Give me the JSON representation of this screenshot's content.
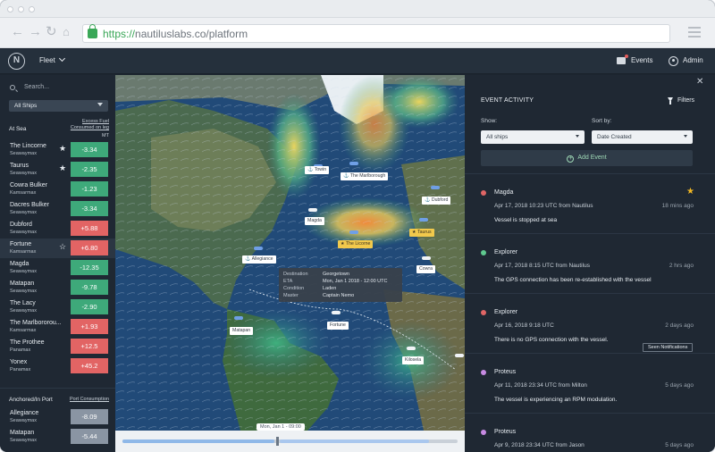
{
  "browser": {
    "url_scheme": "https://",
    "url_rest": "nautiluslabs.co/platform"
  },
  "header": {
    "logo_letter": "N",
    "fleet_label": "Fleet",
    "events_label": "Events",
    "admin_label": "Admin"
  },
  "sidebar": {
    "search_placeholder": "Search...",
    "ships_filter": "All Ships",
    "at_sea_label": "At Sea",
    "excess_fuel_header": "Excess Fuel Consumed on leg",
    "excess_fuel_unit": "MT",
    "at_sea_ships": [
      {
        "name": "The Lincorne",
        "class": "Seawaymax",
        "value": "-3.34",
        "status": "good",
        "starred": "★"
      },
      {
        "name": "Taurus",
        "class": "Seawaymax",
        "value": "-2.35",
        "status": "good",
        "starred": "★"
      },
      {
        "name": "Cowra Bulker",
        "class": "Kamsarmax",
        "value": "-1.23",
        "status": "good",
        "starred": ""
      },
      {
        "name": "Dacres Bulker",
        "class": "Seawaymax",
        "value": "-3.34",
        "status": "good",
        "starred": ""
      },
      {
        "name": "Dubford",
        "class": "Seawaymax",
        "value": "+5.88",
        "status": "bad",
        "starred": ""
      },
      {
        "name": "Fortune",
        "class": "Kamsarmax",
        "value": "+6.80",
        "status": "bad",
        "starred": "☆"
      },
      {
        "name": "Magda",
        "class": "Seawaymax",
        "value": "-12.35",
        "status": "good",
        "starred": ""
      },
      {
        "name": "Matapan",
        "class": "Seawaymax",
        "value": "-9.78",
        "status": "good",
        "starred": ""
      },
      {
        "name": "The Lacy",
        "class": "Seawaymax",
        "value": "-2.90",
        "status": "good",
        "starred": ""
      },
      {
        "name": "The Marlbororou...",
        "class": "Kamsarmax",
        "value": "+1.93",
        "status": "bad",
        "starred": ""
      },
      {
        "name": "The Prothee",
        "class": "Panamax",
        "value": "+12.5",
        "status": "bad",
        "starred": ""
      },
      {
        "name": "Yonex",
        "class": "Panamax",
        "value": "+45.2",
        "status": "bad",
        "starred": ""
      }
    ],
    "anchored_label": "Anchored/In Port",
    "port_consumption_header": "Port Consumption",
    "anchored_ships": [
      {
        "name": "Allegiance",
        "class": "Seawaymax",
        "value": "-8.09"
      },
      {
        "name": "Matapan",
        "class": "Seawaymax",
        "value": "-5.44"
      }
    ]
  },
  "map": {
    "ship_labels": {
      "towin": "Towin",
      "marlborough": "The Marlborough",
      "dubford": "Dubford",
      "magda": "Magda",
      "lincorne": "The Licorne",
      "taurus": "Taurus",
      "allegiance": "Allegiance",
      "cowra": "Cowra",
      "fortune": "Fortune",
      "matapan": "Matapan",
      "kilosela": "Kilosela"
    },
    "tooltip": {
      "destination_label": "Destination",
      "destination_value": "Georgetown",
      "eta_label": "ETA",
      "eta_value": "Mon, Jan 1 2018 - 12:00 UTC",
      "condition_label": "Condition",
      "condition_value": "Laden",
      "master_label": "Master",
      "master_value": "Captain Nemo"
    },
    "time_label": "Mon, Jan 1 - 09:00",
    "timeline_progress": 0.5
  },
  "panel": {
    "title": "EVENT ACTIVITY",
    "filters_label": "Filters",
    "show_label": "Show:",
    "show_value": "All ships",
    "sort_label": "Sort by:",
    "sort_value": "Date Created",
    "add_event_label": "Add Event",
    "seen_notifications_label": "Seen Notifications",
    "events": [
      {
        "ship": "Magda",
        "date": "Apr 17, 2018 10:23 UTC from Nautilus",
        "ago": "18 mins ago",
        "message": "Vessel is stopped at sea",
        "dot_color": "#e06666",
        "star": "★"
      },
      {
        "ship": "Explorer",
        "date": "Apr 17, 2018 8:15 UTC from Nautilus",
        "ago": "2 hrs ago",
        "message": "The GPS connection has been re-established with the vessel",
        "dot_color": "#5fc98f",
        "star": ""
      },
      {
        "ship": "Explorer",
        "date": "Apr 16, 2018 9:18 UTC",
        "ago": "2 days ago",
        "message": "There is no GPS connection with the vessel.",
        "dot_color": "#e06666",
        "star": ""
      },
      {
        "ship": "Proteus",
        "date": "Apr 11, 2018 23:34 UTC from Milton",
        "ago": "5 days ago",
        "message": "The vessel is experiencing an RPM modulation.",
        "dot_color": "#c78be3",
        "star": ""
      },
      {
        "ship": "Proteus",
        "date": "Apr 9, 2018 23:34 UTC from Jason",
        "ago": "5 days ago",
        "message": "",
        "dot_color": "#c78be3",
        "star": ""
      }
    ]
  },
  "colors": {
    "good": "#3ea97a",
    "bad": "#e26464",
    "neutral": "#8a95a3",
    "accent_green": "#9fd9b6",
    "star_gold": "#f2b824"
  }
}
